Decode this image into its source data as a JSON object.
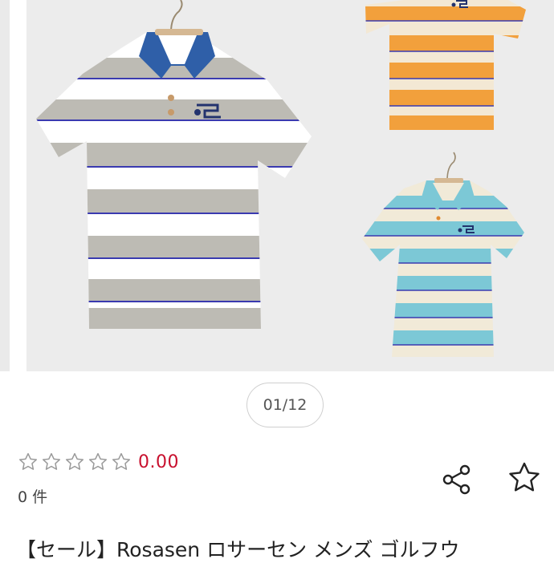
{
  "gallery": {
    "counter": "01/12",
    "images": [
      {
        "icon": "polo-shirt-gray-white-icon",
        "colors": {
          "stripe_a": "#bdbbb4",
          "stripe_b": "#ffffff",
          "collar": "#2f5fa8",
          "pinstripe": "#3a3ab0"
        }
      },
      {
        "icon": "polo-shirt-orange-icon",
        "colors": {
          "stripe_a": "#f2a03c",
          "stripe_b": "#f3e8d4",
          "pinstripe": "#3a3ab0"
        }
      },
      {
        "icon": "polo-shirt-turquoise-icon",
        "colors": {
          "stripe_a": "#7cc8d6",
          "stripe_b": "#f1ead8",
          "pinstripe": "#3a3ab0"
        }
      }
    ]
  },
  "rating": {
    "stars_filled": 0,
    "stars_total": 5,
    "value": "0.00",
    "count_label": "0 件",
    "accent": "#c8102e"
  },
  "actions": {
    "share_icon": "share-icon",
    "favorite_icon": "star-outline-icon"
  },
  "product": {
    "title": "【セール】Rosasen ロサーセン メンズ ゴルフウ"
  }
}
